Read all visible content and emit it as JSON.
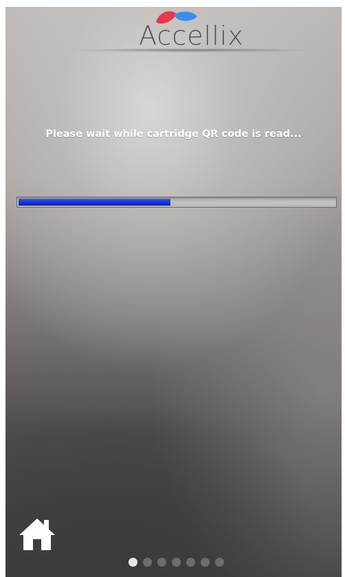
{
  "brand": {
    "name": "Accellix",
    "colors": {
      "red": "#e8374f",
      "blue": "#3a8ee6"
    }
  },
  "status": {
    "message": "Please wait while cartridge QR code is read..."
  },
  "progress": {
    "fraction": 0.48,
    "color": "#1838d6"
  },
  "nav": {
    "home_icon": "home-icon"
  },
  "pager": {
    "total": 7,
    "active_index": 0
  }
}
